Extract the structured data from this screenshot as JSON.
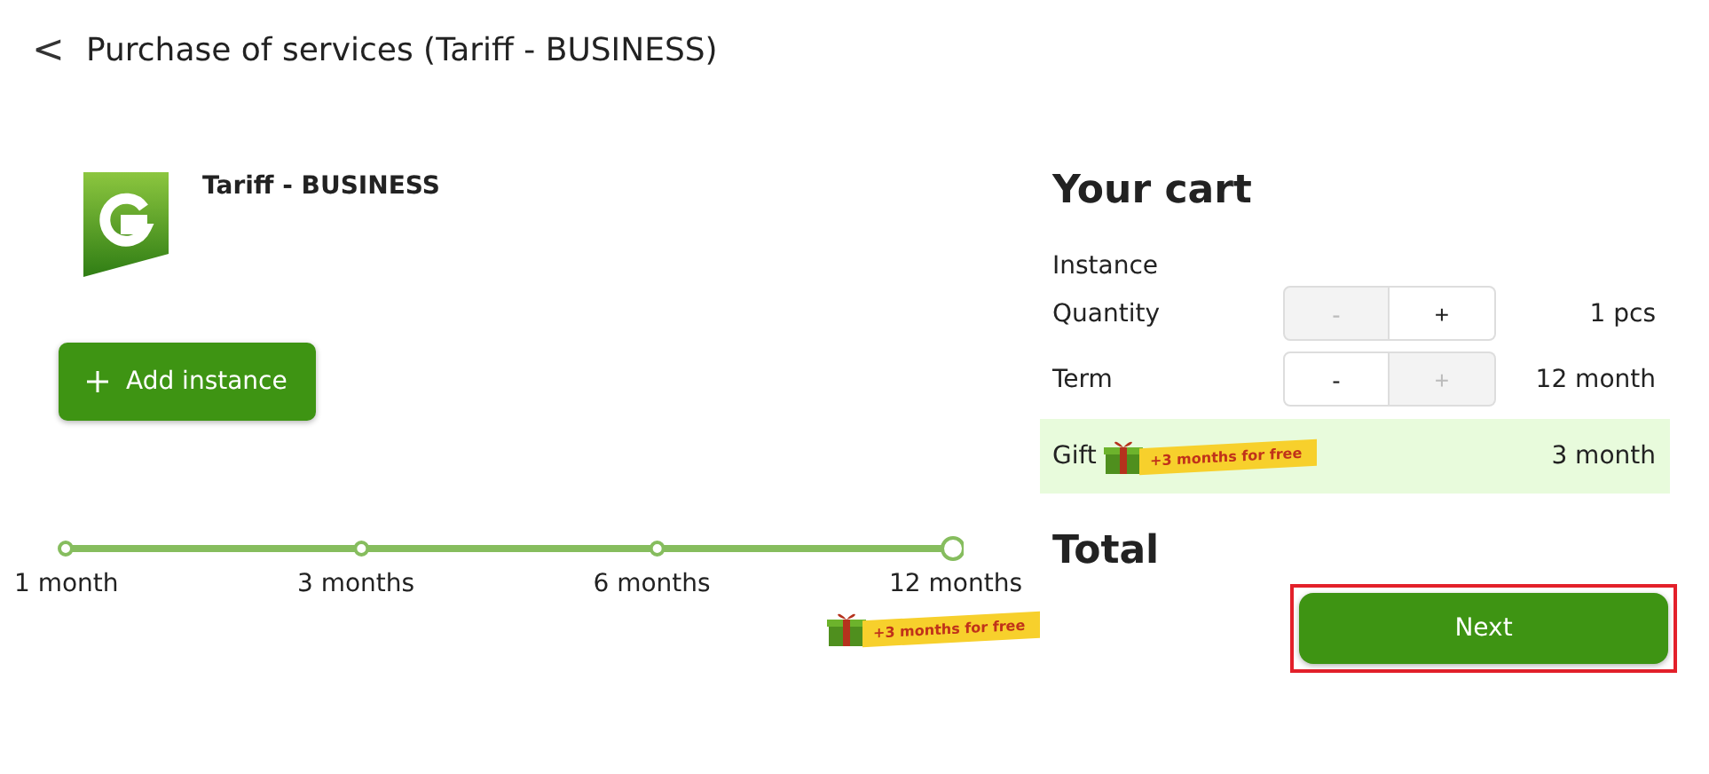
{
  "header": {
    "back_icon": "<",
    "title": "Purchase of services (Tariff - BUSINESS)"
  },
  "product": {
    "name": "Tariff - BUSINESS",
    "add_button": "Add instance"
  },
  "term_slider": {
    "steps": [
      {
        "label": "1 month",
        "selected": false
      },
      {
        "label": "3 months",
        "selected": false
      },
      {
        "label": "6 months",
        "selected": false
      },
      {
        "label": "12 months",
        "selected": true
      }
    ],
    "gift_banner": "+3 months for free"
  },
  "cart": {
    "title": "Your cart",
    "section": "Instance",
    "rows": [
      {
        "kind": "stepper",
        "label": "Quantity",
        "minus": "-",
        "plus": "+",
        "minus_disabled": true,
        "plus_disabled": false,
        "value": "1 pcs"
      },
      {
        "kind": "stepper",
        "label": "Term",
        "minus": "-",
        "plus": "+",
        "minus_disabled": false,
        "plus_disabled": true,
        "value": "12 month"
      },
      {
        "kind": "gift",
        "label": "Gift",
        "banner": "+3 months for free",
        "value": "3 month"
      }
    ],
    "total_label": "Total",
    "next_button": "Next",
    "next_highlighted": true
  }
}
